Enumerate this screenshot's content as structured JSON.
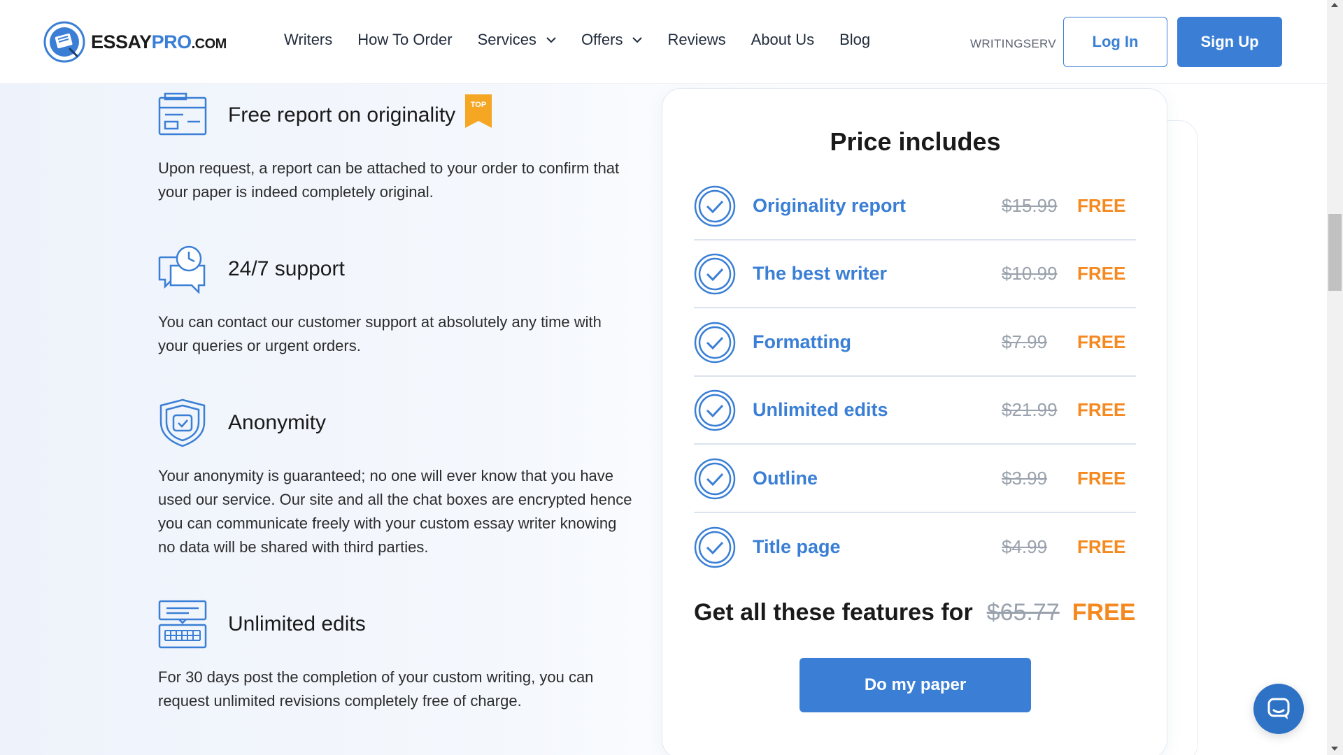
{
  "brand": {
    "name_part1": "ESSAY",
    "name_part2": "PRO",
    "name_part3": ".COM",
    "accent_color": "#3a7fd5",
    "free_color": "#f5891f"
  },
  "nav": {
    "items": [
      {
        "label": "Writers",
        "dropdown": false
      },
      {
        "label": "How To Order",
        "dropdown": false
      },
      {
        "label": "Services",
        "dropdown": true
      },
      {
        "label": "Offers",
        "dropdown": true
      },
      {
        "label": "Reviews",
        "dropdown": false
      },
      {
        "label": "About Us",
        "dropdown": false
      },
      {
        "label": "Blog",
        "dropdown": false
      }
    ],
    "promo_text": "WRITINGSERV",
    "login_label": "Log In",
    "signup_label": "Sign Up"
  },
  "features": [
    {
      "title": "Free report on originality",
      "badge": "TOP",
      "icon": "report-card-icon",
      "description": "Upon request, a report can be attached to your order to confirm that your paper is indeed completely original."
    },
    {
      "title": "24/7 support",
      "icon": "support-chat-clock-icon",
      "description": "You can contact our customer support at absolutely any time with your queries or urgent orders."
    },
    {
      "title": "Anonymity",
      "icon": "shield-check-icon",
      "description": "Your anonymity is guaranteed; no one will ever know that you have used our service. Our site and all the chat boxes are encrypted hence you can communicate freely with your custom essay writer knowing no data will be shared with third parties."
    },
    {
      "title": "Unlimited edits",
      "icon": "keyboard-icon",
      "description": "For 30 days post the completion of your custom writing, you can request unlimited revisions completely free of charge."
    }
  ],
  "price_card": {
    "title": "Price includes",
    "rows": [
      {
        "label": "Originality report",
        "old_price": "$15.99",
        "new_price": "FREE"
      },
      {
        "label": "The best writer",
        "old_price": "$10.99",
        "new_price": "FREE"
      },
      {
        "label": "Formatting",
        "old_price": "$7.99",
        "new_price": "FREE"
      },
      {
        "label": "Unlimited edits",
        "old_price": "$21.99",
        "new_price": "FREE"
      },
      {
        "label": "Outline",
        "old_price": "$3.99",
        "new_price": "FREE"
      },
      {
        "label": "Title page",
        "old_price": "$4.99",
        "new_price": "FREE"
      }
    ],
    "total_label": "Get all these features for",
    "total_old": "$65.77",
    "total_new": "FREE",
    "cta_label": "Do my paper"
  },
  "chat_widget": {
    "icon": "chat-bubble-icon"
  }
}
